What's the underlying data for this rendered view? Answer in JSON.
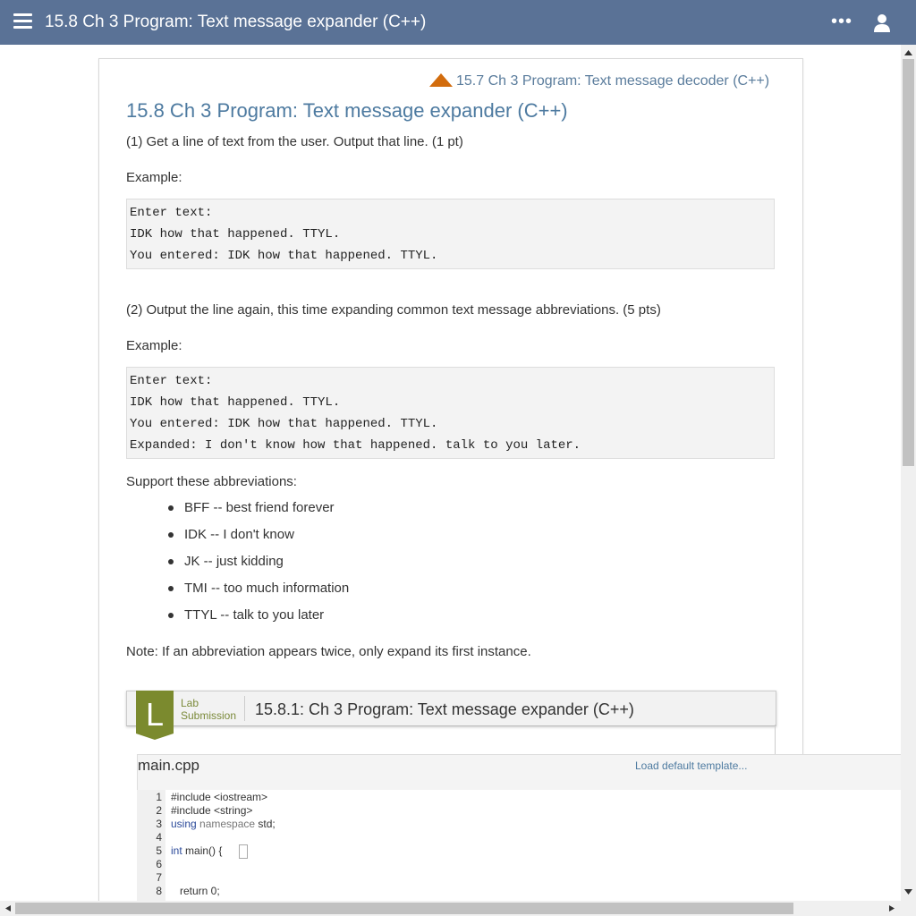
{
  "header": {
    "title": "15.8 Ch 3 Program: Text message expander (C++)"
  },
  "nav": {
    "prev_link": "15.7 Ch 3 Program: Text message decoder (C++)"
  },
  "section": {
    "title": "15.8 Ch 3 Program: Text message expander (C++)",
    "step1": "(1) Get a line of text from the user. Output that line. (1 pt)",
    "example1_label": "Example:",
    "example1_lines": [
      "Enter text:",
      "IDK how that happened. TTYL.",
      "You entered: IDK how that happened. TTYL."
    ],
    "step2": "(2) Output the line again, this time expanding common text message abbreviations. (5 pts)",
    "example2_label": "Example:",
    "example2_lines": [
      "Enter text:",
      "IDK how that happened. TTYL.",
      "You entered: IDK how that happened. TTYL.",
      "Expanded: I don't know how that happened. talk to you later."
    ],
    "support_label": "Support these abbreviations:",
    "abbreviations": [
      "BFF -- best friend forever",
      "IDK -- I don't know",
      "JK -- just kidding",
      "TMI -- too much information",
      "TTYL -- talk to you later"
    ],
    "note": "Note: If an abbreviation appears twice, only expand its first instance."
  },
  "lab": {
    "badge_letter": "L",
    "kind_line1": "Lab",
    "kind_line2": "Submission",
    "title": "15.8.1: Ch 3 Program: Text message expander (C++)",
    "badge_color": "#7b8a2e"
  },
  "editor": {
    "file_name": "main.cpp",
    "load_template": "Load default template...",
    "line_numbers": [
      "1",
      "2",
      "3",
      "4",
      "5",
      "6",
      "7",
      "8"
    ],
    "code": {
      "l1": "#include <iostream>",
      "l2": "#include <string>",
      "l3_kw": "using",
      "l3_kw2": " namespace",
      "l3_rest": " std;",
      "l5_kw": "int",
      "l5_rest": " main() {",
      "l8": "   return 0;"
    }
  },
  "colors": {
    "topbar": "#5a7296",
    "title_link": "#4d7aa0",
    "prev_arrow": "#d26c0d"
  }
}
